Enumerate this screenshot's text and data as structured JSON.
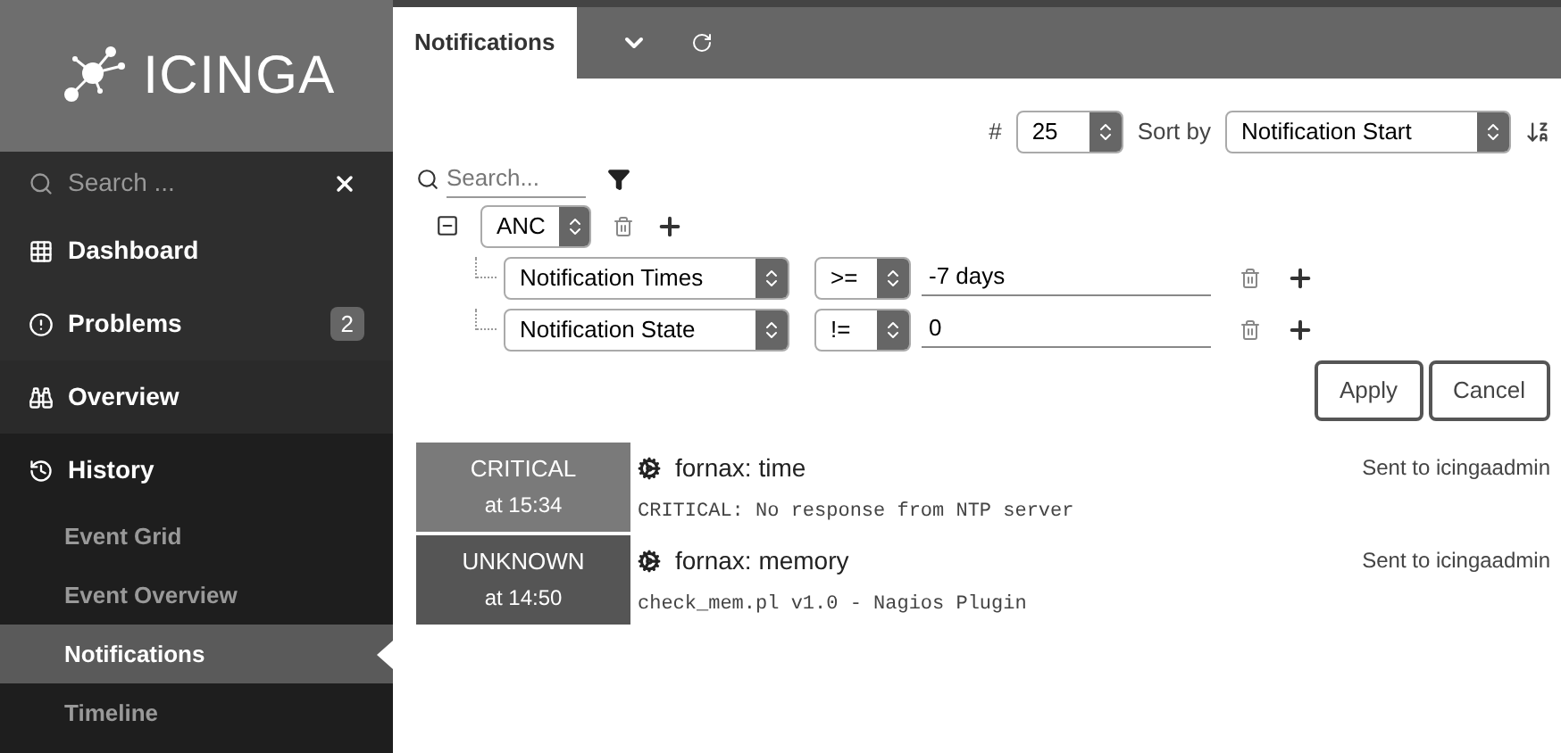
{
  "sidebar": {
    "logo": "ICINGA",
    "search": {
      "placeholder": "Search ..."
    },
    "items": [
      {
        "label": "Dashboard",
        "selected": false
      },
      {
        "label": "Problems",
        "badge": "2",
        "selected": false
      },
      {
        "label": "Overview",
        "selected": false
      },
      {
        "label": "History",
        "selected": false,
        "children": [
          {
            "label": "Event Grid",
            "selected": false
          },
          {
            "label": "Event Overview",
            "selected": false
          },
          {
            "label": "Notifications",
            "selected": true
          },
          {
            "label": "Timeline",
            "selected": false
          }
        ]
      }
    ]
  },
  "tabs": [
    {
      "label": "Notifications",
      "selected": true
    }
  ],
  "controls": {
    "limit_label": "#",
    "limit": "25",
    "sort_label": "Sort by",
    "sort": "Notification Start"
  },
  "search": {
    "placeholder": "Search..."
  },
  "filter": {
    "operator": "ANC",
    "rules": [
      {
        "column": "Notification Times",
        "sign": ">=",
        "value": "-7 days"
      },
      {
        "column": "Notification State",
        "sign": "!=",
        "value": "0"
      }
    ],
    "buttons": [
      "Apply",
      "Cancel"
    ]
  },
  "notifications": [
    {
      "kind": "critical",
      "state_label": "CRITICAL",
      "time": "at 15:34",
      "title": "fornax: time",
      "output": "CRITICAL: No response from NTP server",
      "sent": "Sent to icingaadmin"
    },
    {
      "kind": "unknown",
      "state_label": "UNKNOWN",
      "time": "at 14:50",
      "title": "fornax: memory",
      "output": "check_mem.pl v1.0 - Nagios Plugin",
      "sent": "Sent to icingaadmin"
    }
  ]
}
